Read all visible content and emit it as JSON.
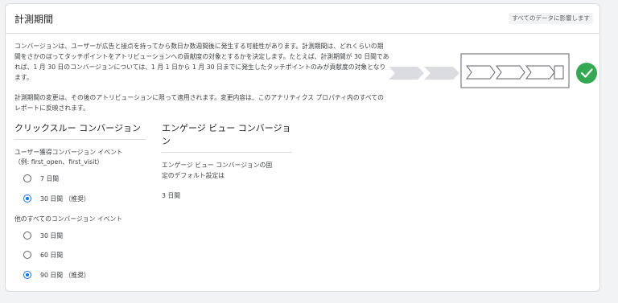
{
  "header": {
    "title": "計測期間",
    "scope_badge": "すべてのデータに影響します"
  },
  "description": {
    "paragraph1": "コンバージョンは、ユーザーが広告と接点を持ってから数日か数週間後に発生する可能性があります。計測期間は、どれくらいの期間をさかのぼってタッチポイントをアトリビューションへの貢献度の対象とするかを決定します。たとえば、計測期間が 30 日間であれば、1 月 30 日のコンバージョンについては、1 月 1 日から 1 月 30 日までに発生したタッチポイントのみが貢献度の対象となります。",
    "paragraph2": "計測期間の変更は、その後のアトリビューションに限って適用されます。変更内容は、このアナリティクス プロパティ内のすべてのレポートに反映されます。"
  },
  "illustration": {
    "check_icon": "check-circle-icon",
    "accent_color": "#34a853"
  },
  "click_through": {
    "heading": "クリックスルー コンバージョン",
    "acquisition": {
      "label_line1": "ユーザー獲得コンバージョン イベント",
      "label_line2": "（例: first_open、first_visit）",
      "options": [
        {
          "label": "7 日間",
          "checked": false
        },
        {
          "label": "30 日間 （推奨）",
          "checked": true
        }
      ]
    },
    "other": {
      "label": "他のすべてのコンバージョン イベント",
      "options": [
        {
          "label": "30 日間",
          "checked": false
        },
        {
          "label": "60 日間",
          "checked": false
        },
        {
          "label": "90 日間 （推奨）",
          "checked": true
        }
      ]
    }
  },
  "engaged_view": {
    "heading_line1": "エンゲージ ビュー コンバージョ",
    "heading_line2": "ン",
    "desc_line1": "エンゲージ ビュー コンバージョンの固",
    "desc_line2": "定のデフォルト設定は",
    "value": "3 日間"
  }
}
